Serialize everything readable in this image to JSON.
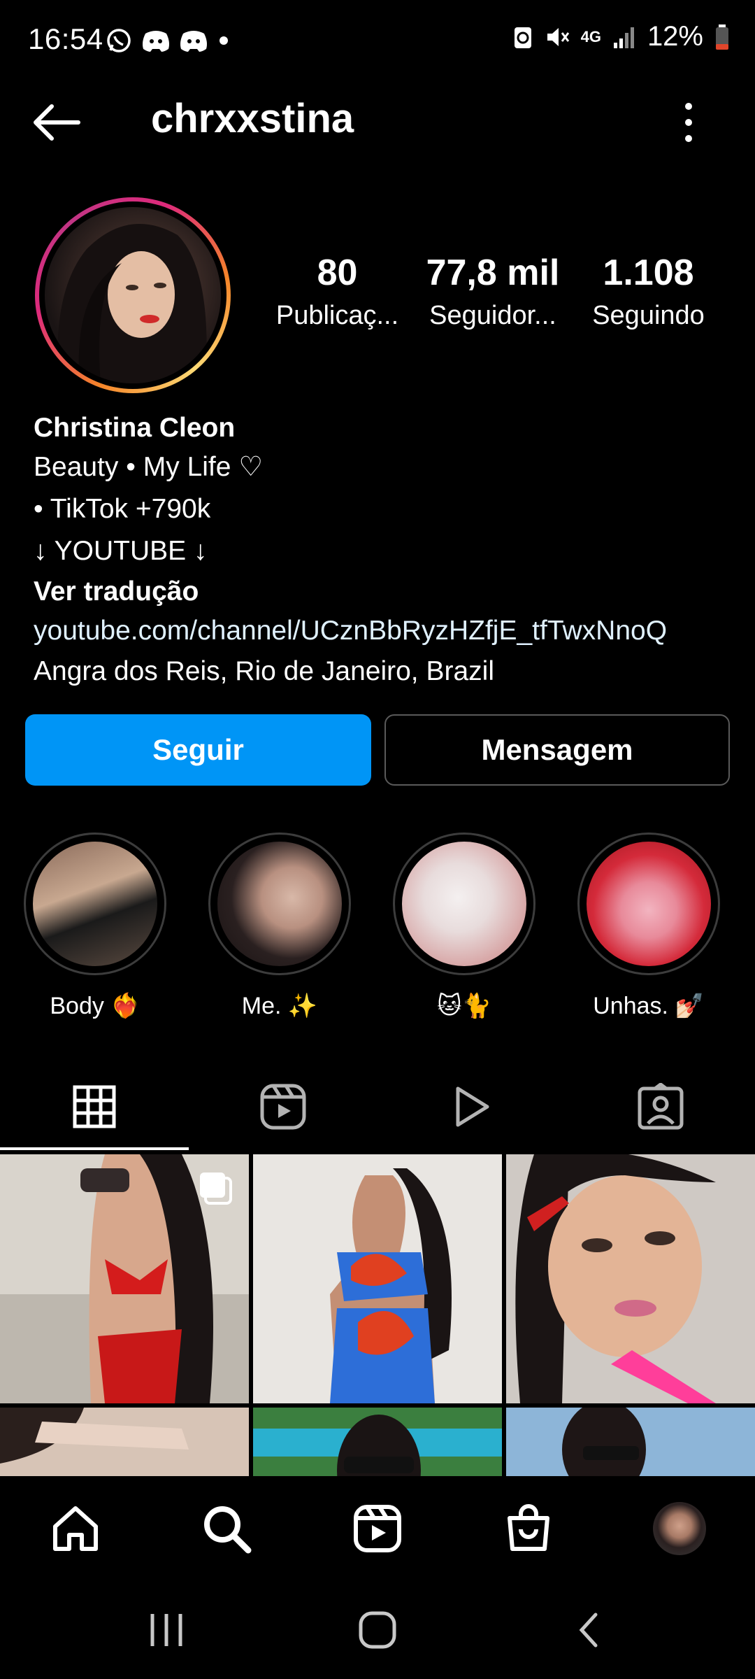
{
  "status_bar": {
    "time": "16:54",
    "battery": "12%",
    "network": "4G"
  },
  "header": {
    "username": "chrxxstina"
  },
  "stats": [
    {
      "value": "80",
      "label": "Publicaç..."
    },
    {
      "value": "77,8 mil",
      "label": "Seguidor..."
    },
    {
      "value": "1.108",
      "label": "Seguindo"
    }
  ],
  "bio": {
    "name": "Christina Cleon",
    "line1": "Beauty • My Life ♡",
    "line2": "• TikTok +790k",
    "line3": "↓ YOUTUBE ↓",
    "translate": "Ver tradução",
    "link": "youtube.com/channel/UCznBbRyzHZfjE_tfTwxNnoQ",
    "location": "Angra dos Reis, Rio de Janeiro, Brazil"
  },
  "buttons": {
    "follow": "Seguir",
    "message": "Mensagem"
  },
  "highlights": [
    {
      "label": "Body ❤️‍🔥"
    },
    {
      "label": "Me. ✨"
    },
    {
      "label": "🐱🐈"
    },
    {
      "label": "Unhas. 💅🏻"
    }
  ],
  "colors": {
    "accent": "#0095f6",
    "background": "#000000",
    "text": "#ffffff"
  },
  "icons": {
    "tabs": [
      "grid-icon",
      "reels-icon",
      "video-icon",
      "tagged-icon"
    ],
    "nav": [
      "home-icon",
      "search-icon",
      "reels-icon",
      "shop-icon",
      "profile-avatar"
    ]
  }
}
